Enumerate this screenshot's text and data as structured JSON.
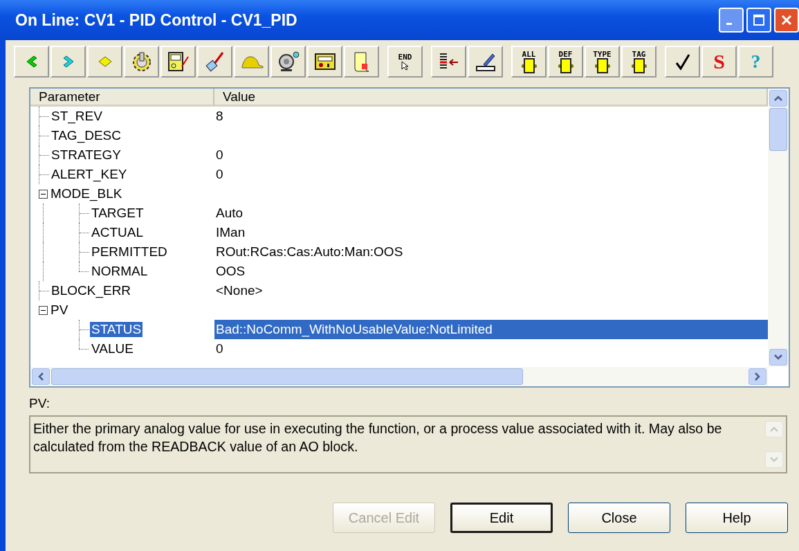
{
  "window": {
    "title": "On Line: CV1  - PID Control - CV1_PID"
  },
  "toolbar": [
    [
      {
        "kind": "back"
      },
      {
        "kind": "forward"
      },
      {
        "kind": "diamond"
      },
      {
        "kind": "gear"
      },
      {
        "kind": "meter"
      },
      {
        "kind": "probe"
      },
      {
        "kind": "cap"
      },
      {
        "kind": "bell"
      },
      {
        "kind": "device"
      },
      {
        "kind": "scroll"
      }
    ],
    [
      {
        "kind": "end",
        "label": "END"
      }
    ],
    [
      {
        "kind": "list"
      },
      {
        "kind": "pencil"
      }
    ],
    [
      {
        "kind": "block",
        "label": "ALL"
      },
      {
        "kind": "block",
        "label": "DEF"
      },
      {
        "kind": "block",
        "label": "TYPE"
      },
      {
        "kind": "block",
        "label": "TAG"
      }
    ],
    [
      {
        "kind": "check"
      },
      {
        "kind": "s",
        "label": "S"
      },
      {
        "kind": "help",
        "label": "?"
      }
    ]
  ],
  "table": {
    "columns": [
      "Parameter",
      "Value"
    ],
    "rows": [
      {
        "name": "ST_REV",
        "value": "8",
        "selected": false
      },
      {
        "name": "TAG_DESC",
        "value": "",
        "selected": false
      },
      {
        "name": "STRATEGY",
        "value": "0",
        "selected": false
      },
      {
        "name": "ALERT_KEY",
        "value": "0",
        "selected": false
      },
      {
        "name": "MODE_BLK",
        "value": "",
        "selected": false,
        "expanded": true,
        "children": [
          {
            "name": "TARGET",
            "value": "Auto",
            "selected": false
          },
          {
            "name": "ACTUAL",
            "value": "IMan",
            "selected": false
          },
          {
            "name": "PERMITTED",
            "value": "ROut:RCas:Cas:Auto:Man:OOS",
            "selected": false
          },
          {
            "name": "NORMAL",
            "value": "OOS",
            "selected": false
          }
        ]
      },
      {
        "name": "BLOCK_ERR",
        "value": "<None>",
        "selected": false
      },
      {
        "name": "PV",
        "value": "",
        "selected": false,
        "expanded": true,
        "children": [
          {
            "name": "STATUS",
            "value": "Bad::NoComm_WithNoUsableValue:NotLimited",
            "selected": true
          },
          {
            "name": "VALUE",
            "value": "0",
            "selected": false
          }
        ]
      }
    ]
  },
  "description": {
    "label": "PV:",
    "text": "Either the primary analog value for use in executing the function, or a process value associated with it.  May also be calculated from the READBACK value of an AO block."
  },
  "buttons": [
    {
      "label": "Cancel Edit",
      "disabled": true,
      "default": false
    },
    {
      "label": "Edit",
      "disabled": false,
      "default": true
    },
    {
      "label": "Close",
      "disabled": false,
      "default": false
    },
    {
      "label": "Help",
      "disabled": false,
      "default": false
    }
  ]
}
